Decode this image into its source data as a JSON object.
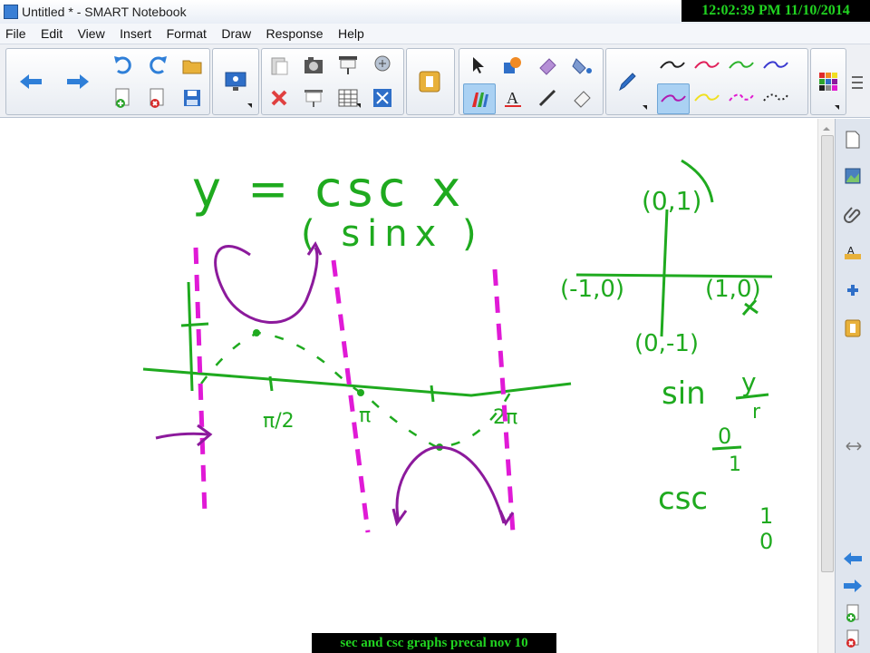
{
  "window": {
    "title": "Untitled * - SMART Notebook"
  },
  "clock": "12:02:39 PM 11/10/2014",
  "menu": [
    "File",
    "Edit",
    "View",
    "Insert",
    "Format",
    "Draw",
    "Response",
    "Help"
  ],
  "toolbar": {
    "left_groups": [
      [
        "back-arrow-icon",
        "forward-arrow-icon",
        "undo-icon",
        "redo-icon",
        "add-page-icon",
        "delete-page-icon",
        "open-folder-icon",
        "save-icon"
      ],
      [
        "screen-share-icon"
      ],
      [
        "paste-icon",
        "delete-icon",
        "screen-capture-icon",
        "screen-shade-icon",
        "table-icon",
        "full-screen-icon"
      ],
      [
        "document-camera-icon"
      ]
    ],
    "tools": [
      "select-icon",
      "shapes-icon",
      "eraser-tool-icon",
      "fill-icon",
      "magic-pen-icon",
      "text-icon",
      "line-icon",
      "eraser-icon"
    ],
    "pens": [
      {
        "icon": "pen-icon",
        "color": "#333333"
      },
      {
        "icon": "pen-stroke-black-icon",
        "color": "#222222"
      },
      {
        "icon": "pen-stroke-red-icon",
        "color": "#e0205a"
      },
      {
        "icon": "pen-stroke-green-icon",
        "color": "#2db32d"
      },
      {
        "icon": "pen-stroke-blue-icon",
        "color": "#3a3ad0"
      },
      {
        "icon": "pen-stroke-purple-icon",
        "color": "#b01ab0"
      },
      {
        "icon": "pen-stroke-yellow-icon",
        "color": "#f0e020"
      },
      {
        "icon": "pen-stroke-magenta-dashed-icon",
        "color": "#e01ad0"
      },
      {
        "icon": "pen-stroke-black-dashed-icon",
        "color": "#222222"
      }
    ],
    "palette_icon": "color-palette-icon"
  },
  "sidebar": [
    "page-sorter-icon",
    "gallery-icon",
    "attachments-icon",
    "properties-icon",
    "addons-icon",
    "response-icon"
  ],
  "canvas": {
    "colors": {
      "ink_green": "#1faa1f",
      "ink_purple": "#8c1a9c",
      "ink_magenta": "#e01ad6"
    },
    "texts": {
      "eq_main": "y = csc x",
      "eq_paren": "( sinx )",
      "pi_half": "π/2",
      "pi": "π",
      "two_pi": "2π",
      "pt_top": "(0,1)",
      "pt_left": "(-1,0)",
      "pt_right": "(1,0)",
      "pt_bottom": "(0,-1)",
      "sin_label": "sin",
      "sin_frac_num": "y",
      "sin_frac_den": "r",
      "sin_val_num": "0",
      "sin_val_den": "1",
      "csc_label": "csc",
      "csc_val_num": "1",
      "csc_val_den": "0"
    }
  },
  "caption": "sec and csc graphs precal  nov 10"
}
